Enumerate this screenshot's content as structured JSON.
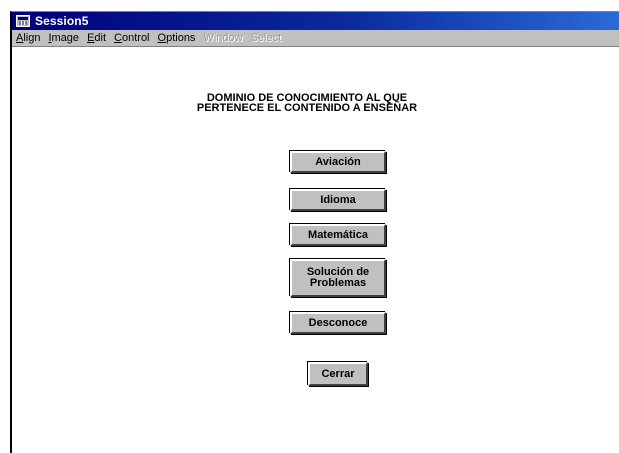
{
  "window": {
    "title": "Session5"
  },
  "menubar": {
    "items": [
      {
        "text": "Align",
        "mnemonic": "A",
        "rest": "lign",
        "enabled": true
      },
      {
        "text": "Image",
        "mnemonic": "I",
        "rest": "mage",
        "enabled": true
      },
      {
        "text": "Edit",
        "mnemonic": "E",
        "rest": "dit",
        "enabled": true
      },
      {
        "text": "Control",
        "mnemonic": "C",
        "rest": "ontrol",
        "enabled": true
      },
      {
        "text": "Options",
        "mnemonic": "O",
        "rest": "ptions",
        "enabled": true
      },
      {
        "text": "Window",
        "mnemonic": "",
        "rest": "Window",
        "enabled": false
      },
      {
        "text": "Select",
        "mnemonic": "",
        "rest": "Select",
        "enabled": false
      }
    ]
  },
  "main": {
    "heading_line1": "DOMINIO DE CONOCIMIENTO AL QUE",
    "heading_line2": "PERTENECE EL CONTENIDO A ENSEÑAR",
    "buttons": {
      "aviacion": "Aviación",
      "idioma": "Idioma",
      "matematica": "Matemática",
      "solucion": "Solución de\nProblemas",
      "desconoce": "Desconoce",
      "cerrar": "Cerrar"
    }
  },
  "colors": {
    "titlebar_start": "#00007b",
    "titlebar_end": "#2a6ad8",
    "button_face": "#c0c0c0",
    "menubar_bg": "#c0c0c0"
  },
  "icons": {
    "app": "session-window-icon"
  }
}
